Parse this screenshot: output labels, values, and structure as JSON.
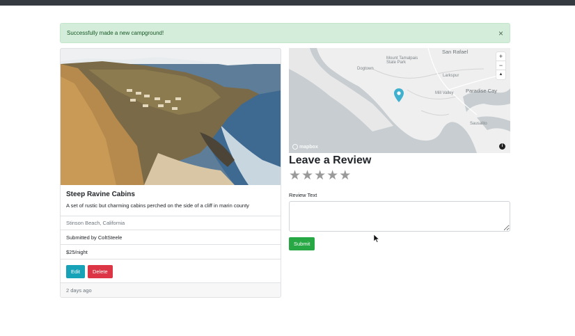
{
  "alert": {
    "message": "Successfully made a new campground!",
    "close_symbol": "×"
  },
  "campground": {
    "title": "Steep Ravine Cabins",
    "description": "A set of rustic but charming cabins perched on the side of a cliff in marin county",
    "location": "Stinson Beach, California",
    "submitted_by": "Submitted by ColtSteele",
    "price": "$25/night",
    "edit_label": "Edit",
    "delete_label": "Delete",
    "posted": "2 days ago"
  },
  "map": {
    "labels": [
      "San Rafael",
      "Mount Tamalpais State Park",
      "Larkspur",
      "Dogtown",
      "Mill Valley",
      "Paradise Cay",
      "Sausalito"
    ],
    "zoom_in": "+",
    "zoom_out": "−",
    "compass": "▲",
    "attribution": "mapbox",
    "info": "i",
    "marker_color": "#3fb1ce"
  },
  "review": {
    "heading": "Leave a Review",
    "stars": [
      "★",
      "★",
      "★",
      "★",
      "★"
    ],
    "label": "Review Text",
    "textarea_value": "",
    "submit_label": "Submit"
  },
  "colors": {
    "success": "#28a745",
    "info": "#17a2b8",
    "danger": "#dc3545",
    "alert_bg": "#d4edda"
  }
}
